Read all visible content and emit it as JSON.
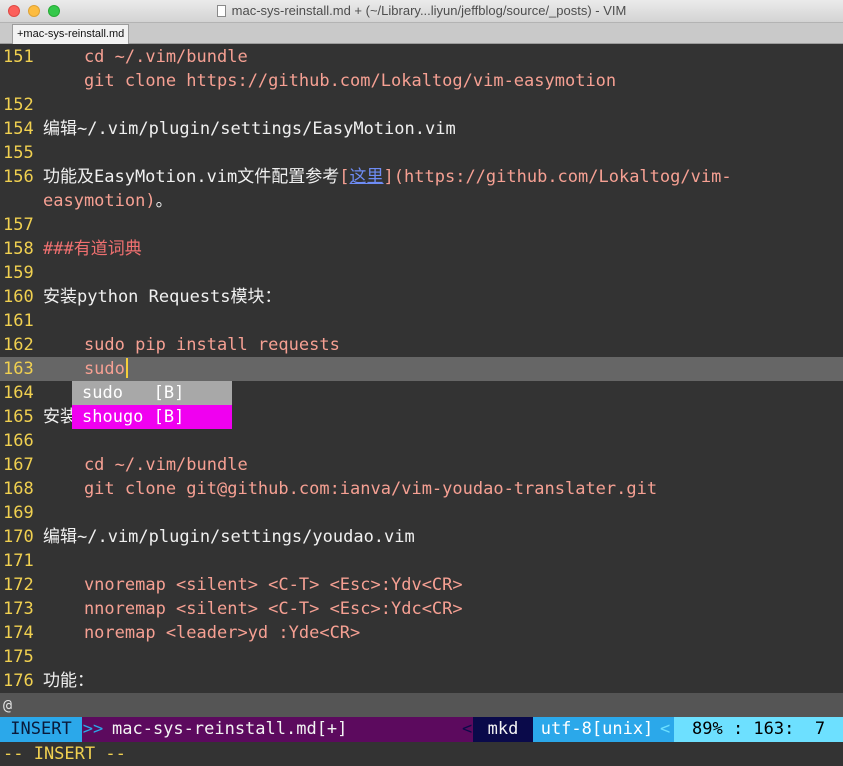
{
  "window": {
    "title": "mac-sys-reinstall.md + (~/Library...liyun/jeffblog/source/_posts) - VIM"
  },
  "tab": {
    "label": "+mac-sys-reinstall.md"
  },
  "lines": [
    {
      "num": "151",
      "text": "    cd ~/.vim/bundle",
      "style": "code"
    },
    {
      "num": "",
      "text": "    git clone https://github.com/Lokaltog/vim-easymotion",
      "style": "code"
    },
    {
      "num": "152",
      "text": "",
      "style": "plain"
    },
    {
      "num": "154",
      "text": "编辑~/.vim/plugin/settings/EasyMotion.vim",
      "style": "plain"
    },
    {
      "num": "155",
      "text": "",
      "style": "plain"
    },
    {
      "num": "156",
      "text_pre": "功能及EasyMotion.vim文件配置参考",
      "open_bracket": "[",
      "link_text": "这里",
      "close_bracket": "]",
      "url": "(https://github.com/Lokaltog/vim-",
      "style": "link-line"
    },
    {
      "num": "",
      "text": "easymotion)",
      "tail": "。",
      "style": "url-cont"
    },
    {
      "num": "157",
      "text": "",
      "style": "plain"
    },
    {
      "num": "158",
      "text": "###有道词典",
      "style": "hdr"
    },
    {
      "num": "159",
      "text": "",
      "style": "plain"
    },
    {
      "num": "160",
      "text": "安装python Requests模块：",
      "style": "plain"
    },
    {
      "num": "161",
      "text": "",
      "style": "plain"
    },
    {
      "num": "162",
      "text": "    sudo pip install requests",
      "style": "code"
    },
    {
      "num": "163",
      "text": "    sudo",
      "style": "current"
    },
    {
      "num": "164",
      "text": "",
      "style": "plain"
    },
    {
      "num": "165",
      "text": "安装",
      "style": "plain"
    },
    {
      "num": "166",
      "text": "",
      "style": "plain"
    },
    {
      "num": "167",
      "text": "    cd ~/.vim/bundle",
      "style": "code"
    },
    {
      "num": "168",
      "text": "    git clone git@github.com:ianva/vim-youdao-translater.git",
      "style": "code"
    },
    {
      "num": "169",
      "text": "",
      "style": "plain"
    },
    {
      "num": "170",
      "text": "编辑~/.vim/plugin/settings/youdao.vim",
      "style": "plain"
    },
    {
      "num": "171",
      "text": "",
      "style": "plain"
    },
    {
      "num": "172",
      "text": "    vnoremap <silent> <C-T> <Esc>:Ydv<CR>",
      "style": "code"
    },
    {
      "num": "173",
      "text": "    nnoremap <silent> <C-T> <Esc>:Ydc<CR>",
      "style": "code"
    },
    {
      "num": "174",
      "text": "    noremap <leader>yd :Yde<CR>",
      "style": "code"
    },
    {
      "num": "175",
      "text": "",
      "style": "plain"
    },
    {
      "num": "176",
      "text": "功能：",
      "style": "plain"
    }
  ],
  "popup": [
    {
      "label": "sudo   [B]"
    },
    {
      "label": "shougo [B]"
    }
  ],
  "atline": "@",
  "status": {
    "mode": "INSERT",
    "arrow_right": ">>",
    "filename": "mac-sys-reinstall.md[+]",
    "arrow_left": "<",
    "filetype": "mkd",
    "encoding": "utf-8[unix]",
    "position": "89% : 163:  7"
  },
  "cmdline": "-- INSERT --",
  "colors": {
    "background": "#333333",
    "line_number": "#f0d050",
    "code_text": "#f6a093",
    "status_bg": "#5c0a5e",
    "mode_bg": "#2ba8ea",
    "popup_selected": "#f000f0"
  }
}
